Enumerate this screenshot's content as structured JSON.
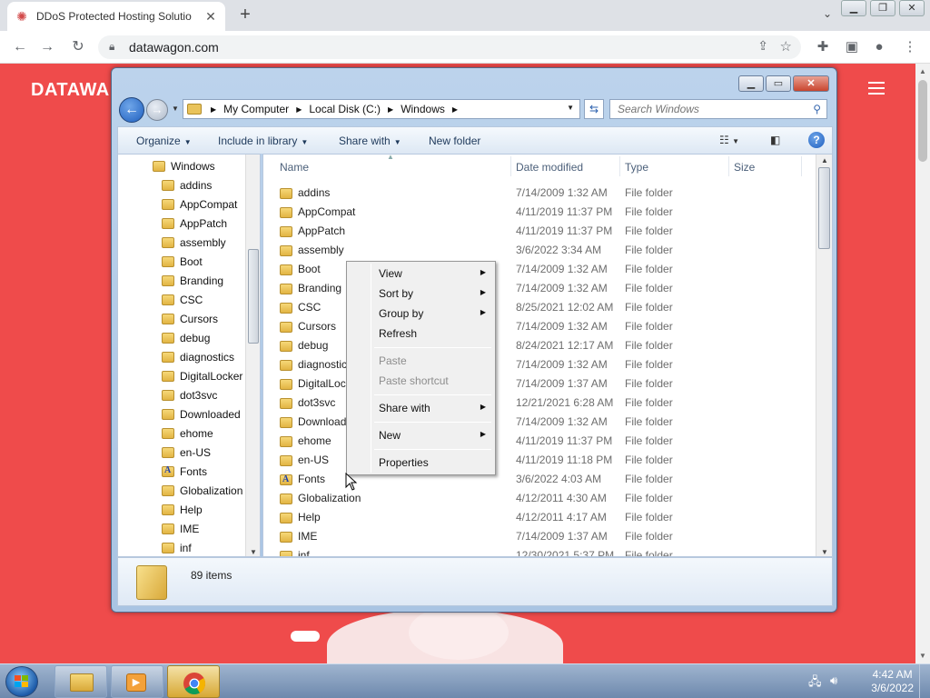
{
  "browser": {
    "tab_title": "DDoS Protected Hosting Solutio",
    "url": "datawagon.com"
  },
  "site": {
    "logo": "DATAWA"
  },
  "explorer": {
    "breadcrumbs": [
      "My Computer",
      "Local Disk (C:)",
      "Windows"
    ],
    "search_placeholder": "Search Windows",
    "toolbar": {
      "organize": "Organize",
      "include": "Include in library",
      "share": "Share with",
      "new_folder": "New folder"
    },
    "nav": {
      "head": "Windows",
      "items": [
        "addins",
        "AppCompat",
        "AppPatch",
        "assembly",
        "Boot",
        "Branding",
        "CSC",
        "Cursors",
        "debug",
        "diagnostics",
        "DigitalLocker",
        "dot3svc",
        "Downloaded",
        "ehome",
        "en-US",
        "Fonts",
        "Globalization",
        "Help",
        "IME",
        "inf"
      ]
    },
    "columns": {
      "name": "Name",
      "date": "Date modified",
      "type": "Type",
      "size": "Size"
    },
    "files": [
      {
        "name": "addins",
        "date": "7/14/2009 1:32 AM",
        "type": "File folder"
      },
      {
        "name": "AppCompat",
        "date": "4/11/2019 11:37 PM",
        "type": "File folder"
      },
      {
        "name": "AppPatch",
        "date": "4/11/2019 11:37 PM",
        "type": "File folder"
      },
      {
        "name": "assembly",
        "date": "3/6/2022 3:34 AM",
        "type": "File folder"
      },
      {
        "name": "Boot",
        "date": "7/14/2009 1:32 AM",
        "type": "File folder"
      },
      {
        "name": "Branding",
        "date": "7/14/2009 1:32 AM",
        "type": "File folder"
      },
      {
        "name": "CSC",
        "date": "8/25/2021 12:02 AM",
        "type": "File folder"
      },
      {
        "name": "Cursors",
        "date": "7/14/2009 1:32 AM",
        "type": "File folder"
      },
      {
        "name": "debug",
        "date": "8/24/2021 12:17 AM",
        "type": "File folder"
      },
      {
        "name": "diagnostic",
        "date": "7/14/2009 1:32 AM",
        "type": "File folder"
      },
      {
        "name": "DigitalLoc",
        "date": "7/14/2009 1:37 AM",
        "type": "File folder"
      },
      {
        "name": "dot3svc",
        "date": "12/21/2021 6:28 AM",
        "type": "File folder"
      },
      {
        "name": "Download",
        "date": "7/14/2009 1:32 AM",
        "type": "File folder"
      },
      {
        "name": "ehome",
        "date": "4/11/2019 11:37 PM",
        "type": "File folder"
      },
      {
        "name": "en-US",
        "date": "4/11/2019 11:18 PM",
        "type": "File folder"
      },
      {
        "name": "Fonts",
        "date": "3/6/2022 4:03 AM",
        "type": "File folder"
      },
      {
        "name": "Globalization",
        "date": "4/12/2011 4:30 AM",
        "type": "File folder"
      },
      {
        "name": "Help",
        "date": "4/12/2011 4:17 AM",
        "type": "File folder"
      },
      {
        "name": "IME",
        "date": "7/14/2009 1:37 AM",
        "type": "File folder"
      },
      {
        "name": "inf",
        "date": "12/30/2021 5:37 PM",
        "type": "File folder"
      }
    ],
    "item_count": "89 items"
  },
  "context_menu": {
    "view": "View",
    "sort_by": "Sort by",
    "group_by": "Group by",
    "refresh": "Refresh",
    "paste": "Paste",
    "paste_shortcut": "Paste shortcut",
    "share_with": "Share with",
    "new": "New",
    "properties": "Properties"
  },
  "taskbar": {
    "time": "4:42 AM",
    "date": "3/6/2022"
  }
}
